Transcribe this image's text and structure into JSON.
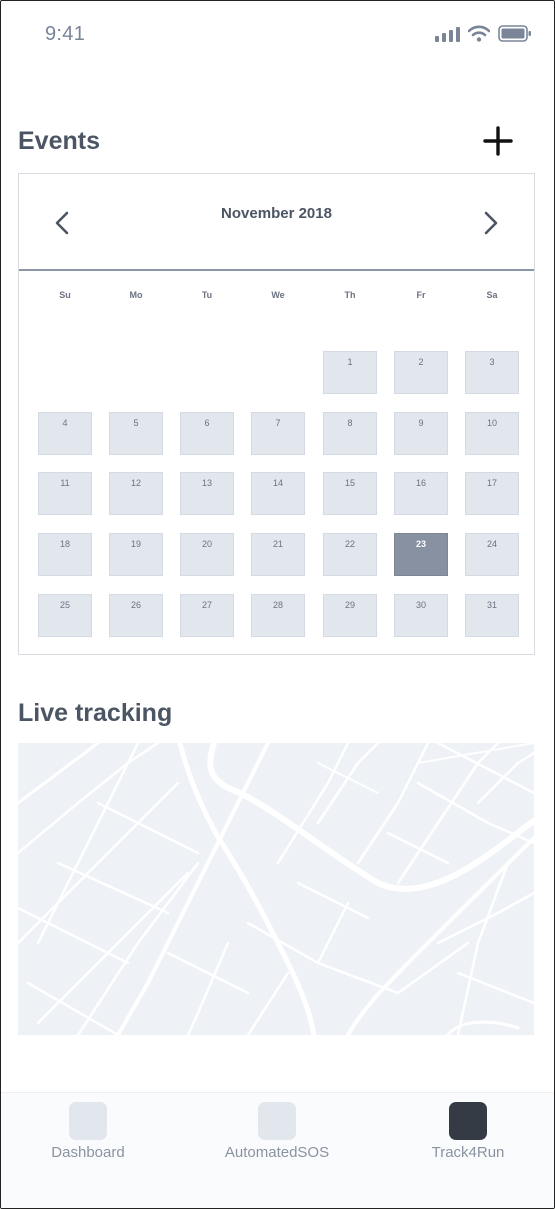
{
  "status_bar": {
    "time": "9:41"
  },
  "events": {
    "title": "Events",
    "calendar": {
      "month_label": "November 2018",
      "weekdays": [
        "Su",
        "Mo",
        "Tu",
        "We",
        "Th",
        "Fr",
        "Sa"
      ],
      "days": [
        "1",
        "2",
        "3",
        "4",
        "5",
        "6",
        "7",
        "8",
        "9",
        "10",
        "11",
        "12",
        "13",
        "14",
        "15",
        "16",
        "17",
        "18",
        "19",
        "20",
        "21",
        "22",
        "23",
        "24",
        "25",
        "26",
        "27",
        "28",
        "29",
        "30",
        "31"
      ],
      "selected_day": "23"
    }
  },
  "live_tracking": {
    "title": "Live tracking"
  },
  "bottom_nav": {
    "items": [
      {
        "label": "Dashboard",
        "active": false
      },
      {
        "label": "AutomatedSOS",
        "active": false
      },
      {
        "label": "Track4Run",
        "active": true
      }
    ]
  },
  "colors": {
    "accent": "#8791a2",
    "active_tab": "#343b45",
    "cell": "#e2e7ee"
  }
}
